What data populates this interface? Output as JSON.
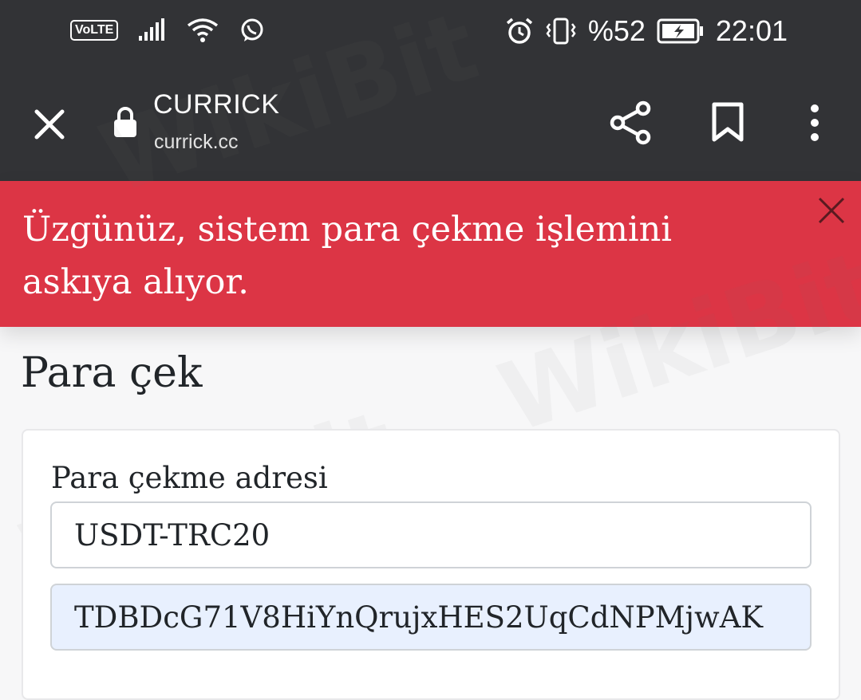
{
  "status_bar": {
    "volte": "VoLTE",
    "battery_percent": "%52",
    "time": "22:01",
    "icons": [
      "signal-icon",
      "wifi-icon",
      "whatsapp-icon",
      "alarm-icon",
      "vibrate-icon",
      "battery-charging-icon"
    ]
  },
  "browser": {
    "site_title": "CURRICK",
    "url": "currick.cc",
    "icons": [
      "close-icon",
      "lock-icon",
      "share-icon",
      "bookmark-icon",
      "more-vert-icon"
    ]
  },
  "alert": {
    "message": "Üzgünüz, sistem para çekme işlemini askıya alıyor.",
    "color": "#dc3545"
  },
  "page": {
    "title": "Para çek"
  },
  "form": {
    "address_label": "Para çekme adresi",
    "network_value": "USDT-TRC20",
    "address_value": "TDBDcG71V8HiYnQrujxHES2UqCdNPMjwAK"
  },
  "colors": {
    "chrome": "#323336",
    "autofill": "#e8f0fe"
  },
  "watermark": "WikiBit"
}
